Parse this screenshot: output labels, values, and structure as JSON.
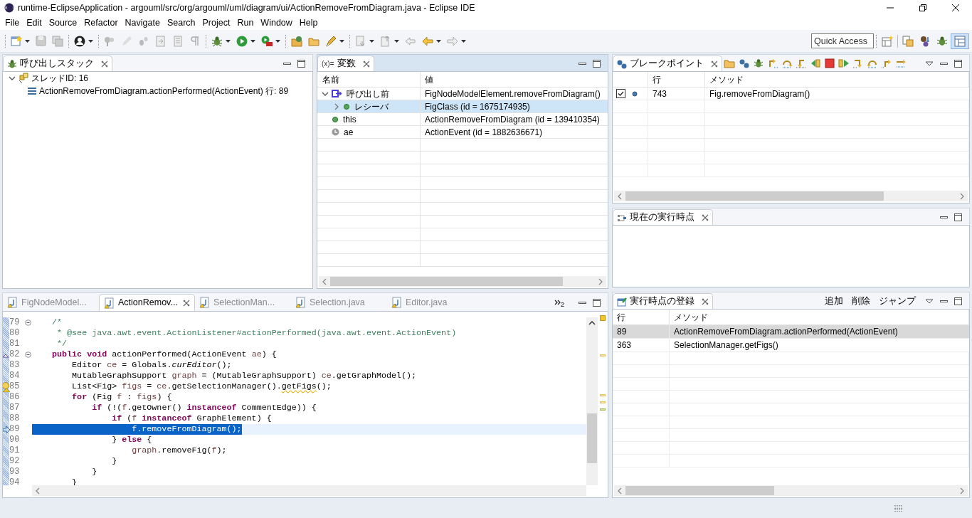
{
  "window": {
    "title": "runtime-EclipseApplication - argouml/src/org/argouml/uml/diagram/ui/ActionRemoveFromDiagram.java - Eclipse IDE"
  },
  "menu": [
    "File",
    "Edit",
    "Source",
    "Refactor",
    "Navigate",
    "Search",
    "Project",
    "Run",
    "Window",
    "Help"
  ],
  "quick_access": {
    "placeholder": "Quick Access"
  },
  "call_stack": {
    "tab": {
      "label": "呼び出しスタック",
      "selected": true
    },
    "active": false,
    "tree": [
      {
        "label": "スレッドID: 16",
        "expanded": true,
        "children": [
          {
            "label": "ActionRemoveFromDiagram.actionPerformed(ActionEvent) 行: 89"
          }
        ]
      }
    ]
  },
  "variables": {
    "tab": {
      "icon": "(x)=",
      "label": "変数",
      "selected": true
    },
    "active": true,
    "columns": [
      "名前",
      "値"
    ],
    "rows": [
      {
        "name": "呼び出し前",
        "value": "FigNodeModelElement.removeFromDiagram()",
        "kind": "result",
        "selected": false,
        "expanded": true,
        "children": [
          {
            "name": "レシーバ",
            "value": "FigClass (id = 1675174935)",
            "kind": "field",
            "selected": true,
            "expanded": false
          }
        ]
      },
      {
        "name": "this",
        "value": "ActionRemoveFromDiagram (id = 139410354)",
        "kind": "field",
        "selected": false
      },
      {
        "name": "ae",
        "value": "ActionEvent (id = 1882636671)",
        "kind": "local",
        "selected": false
      }
    ]
  },
  "editor": {
    "tabs": [
      {
        "label": "FigNodeModel...",
        "selected": false
      },
      {
        "label": "ActionRemov...",
        "selected": true
      },
      {
        "label": "SelectionMan...",
        "selected": false
      },
      {
        "label": "Selection.java",
        "selected": false
      },
      {
        "label": "Editor.java",
        "selected": false
      }
    ],
    "overflow_count": "2",
    "lines": [
      {
        "number": "79",
        "fold": true,
        "override": false,
        "warning": false,
        "current": false,
        "tokens": [
          {
            "kind": "comment",
            "text": "    /*"
          }
        ]
      },
      {
        "number": "80",
        "fold": false,
        "override": false,
        "warning": false,
        "current": false,
        "tokens": [
          {
            "kind": "comment",
            "text": "     * @see java.awt.event.ActionListener#actionPerformed(java.awt.event.ActionEvent)"
          }
        ]
      },
      {
        "number": "81",
        "fold": false,
        "override": false,
        "warning": false,
        "current": false,
        "tokens": [
          {
            "kind": "comment",
            "text": "     */"
          }
        ]
      },
      {
        "number": "82",
        "fold": true,
        "override": true,
        "warning": false,
        "current": false,
        "tokens": [
          {
            "kind": "keyword",
            "text": "    public"
          },
          {
            "kind": "keyword",
            "text": " void"
          },
          {
            "kind": "plain",
            "text": " actionPerformed(ActionEvent "
          },
          {
            "kind": "variable",
            "text": "ae"
          },
          {
            "kind": "plain",
            "text": ") {"
          }
        ]
      },
      {
        "number": "83",
        "fold": false,
        "override": false,
        "warning": false,
        "current": false,
        "tokens": [
          {
            "kind": "plain",
            "text": "        Editor "
          },
          {
            "kind": "variable",
            "text": "ce"
          },
          {
            "kind": "plain",
            "text": " = Globals."
          },
          {
            "kind": "static",
            "text": "curEditor"
          },
          {
            "kind": "plain",
            "text": "();"
          }
        ]
      },
      {
        "number": "84",
        "fold": false,
        "override": false,
        "warning": false,
        "current": false,
        "tokens": [
          {
            "kind": "plain",
            "text": "        MutableGraphSupport "
          },
          {
            "kind": "variable",
            "text": "graph"
          },
          {
            "kind": "plain",
            "text": " = (MutableGraphSupport) "
          },
          {
            "kind": "variable",
            "text": "ce"
          },
          {
            "kind": "plain",
            "text": ".getGraphModel();"
          }
        ]
      },
      {
        "number": "85",
        "fold": false,
        "override": false,
        "warning": true,
        "current": false,
        "tokens": [
          {
            "kind": "plain",
            "text": "        List<Fig> "
          },
          {
            "kind": "variable",
            "text": "figs"
          },
          {
            "kind": "plain",
            "text": " = "
          },
          {
            "kind": "variable",
            "text": "ce"
          },
          {
            "kind": "plain",
            "text": ".getSelectionManager()."
          },
          {
            "kind": "deprecated",
            "text": "getFigs"
          },
          {
            "kind": "plain",
            "text": "();"
          }
        ]
      },
      {
        "number": "86",
        "fold": false,
        "override": false,
        "warning": false,
        "current": false,
        "tokens": [
          {
            "kind": "keyword",
            "text": "        for"
          },
          {
            "kind": "plain",
            "text": " (Fig "
          },
          {
            "kind": "variable",
            "text": "f"
          },
          {
            "kind": "plain",
            "text": " : "
          },
          {
            "kind": "variable",
            "text": "figs"
          },
          {
            "kind": "plain",
            "text": ") {"
          }
        ]
      },
      {
        "number": "87",
        "fold": false,
        "override": false,
        "warning": false,
        "current": false,
        "tokens": [
          {
            "kind": "keyword",
            "text": "            if"
          },
          {
            "kind": "plain",
            "text": " (!("
          },
          {
            "kind": "variable",
            "text": "f"
          },
          {
            "kind": "plain",
            "text": ".getOwner() "
          },
          {
            "kind": "keyword",
            "text": "instanceof"
          },
          {
            "kind": "plain",
            "text": " CommentEdge)) {"
          }
        ]
      },
      {
        "number": "88",
        "fold": false,
        "override": false,
        "warning": false,
        "current": false,
        "tokens": [
          {
            "kind": "keyword",
            "text": "                if"
          },
          {
            "kind": "plain",
            "text": " ("
          },
          {
            "kind": "variable",
            "text": "f"
          },
          {
            "kind": "keyword",
            "text": " instanceof"
          },
          {
            "kind": "plain",
            "text": " GraphElement) {"
          }
        ]
      },
      {
        "number": "89",
        "fold": false,
        "override": false,
        "warning": false,
        "current": true,
        "tokens": [
          {
            "kind": "variable",
            "text": "                    f"
          },
          {
            "kind": "plain",
            "text": ".removeFromDiagram();"
          }
        ]
      },
      {
        "number": "90",
        "fold": false,
        "override": false,
        "warning": false,
        "current": false,
        "tokens": [
          {
            "kind": "plain",
            "text": "                } "
          },
          {
            "kind": "keyword",
            "text": "else"
          },
          {
            "kind": "plain",
            "text": " {"
          }
        ]
      },
      {
        "number": "91",
        "fold": false,
        "override": false,
        "warning": false,
        "current": false,
        "tokens": [
          {
            "kind": "variable",
            "text": "                    graph"
          },
          {
            "kind": "plain",
            "text": ".removeFig("
          },
          {
            "kind": "variable",
            "text": "f"
          },
          {
            "kind": "plain",
            "text": ");"
          }
        ]
      },
      {
        "number": "92",
        "fold": false,
        "override": false,
        "warning": false,
        "current": false,
        "tokens": [
          {
            "kind": "plain",
            "text": "                }"
          }
        ]
      },
      {
        "number": "93",
        "fold": false,
        "override": false,
        "warning": false,
        "current": false,
        "tokens": [
          {
            "kind": "plain",
            "text": "            }"
          }
        ]
      },
      {
        "number": "94",
        "fold": false,
        "override": false,
        "warning": false,
        "current": false,
        "tokens": [
          {
            "kind": "plain",
            "text": "        }"
          }
        ]
      }
    ]
  },
  "breakpoints": {
    "tab": {
      "label": "ブレークポイント",
      "selected": true
    },
    "active": false,
    "columns": [
      "行",
      "メソッド"
    ],
    "rows": [
      {
        "checked": true,
        "line": "743",
        "method": "Fig.removeFromDiagram()"
      }
    ]
  },
  "current_point": {
    "tab": {
      "label": "現在の実行時点",
      "selected": true
    },
    "active": false
  },
  "registry": {
    "tab": {
      "label": "実行時点の登録",
      "selected": true
    },
    "active": false,
    "actions": [
      "追加",
      "削除",
      "ジャンプ"
    ],
    "columns": [
      "行",
      "メソッド"
    ],
    "rows": [
      {
        "line": "89",
        "method": "ActionRemoveFromDiagram.actionPerformed(ActionEvent)",
        "selected": true
      },
      {
        "line": "363",
        "method": "SelectionManager.getFigs()",
        "selected": false
      }
    ]
  }
}
